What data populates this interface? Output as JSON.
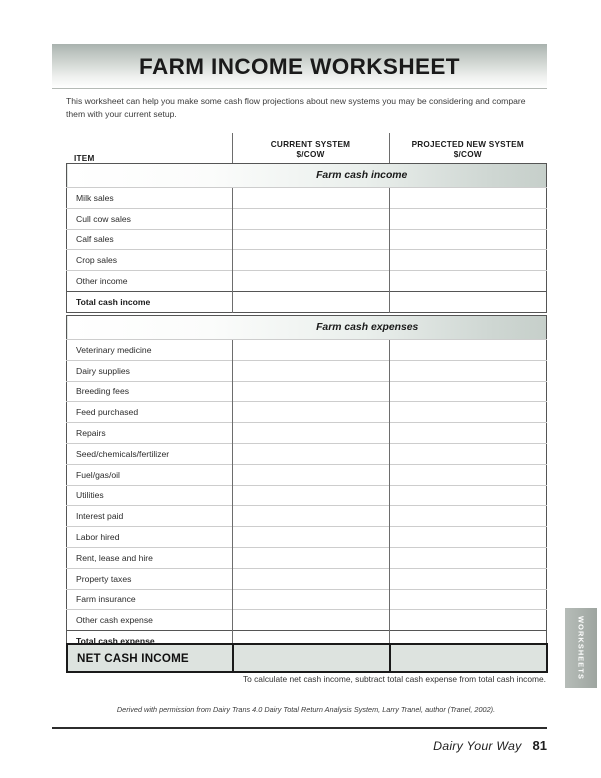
{
  "document": {
    "title": "FARM INCOME WORKSHEET",
    "intro": "This worksheet can help you make some cash flow projections about new systems you may be considering and compare them with your current setup."
  },
  "table": {
    "headers": {
      "item": "ITEM",
      "current_system_line1": "CURRENT SYSTEM",
      "current_system_line2": "$/COW",
      "projected_system_line1": "PROJECTED NEW SYSTEM",
      "projected_system_line2": "$/COW"
    },
    "income": {
      "section_title": "Farm cash income",
      "rows": [
        {
          "label": "Milk sales",
          "current": "",
          "projected": ""
        },
        {
          "label": "Cull cow sales",
          "current": "",
          "projected": ""
        },
        {
          "label": "Calf sales",
          "current": "",
          "projected": ""
        },
        {
          "label": "Crop sales",
          "current": "",
          "projected": ""
        },
        {
          "label": "Other income",
          "current": "",
          "projected": ""
        }
      ],
      "total": {
        "label": "Total cash income",
        "current": "",
        "projected": ""
      }
    },
    "expenses": {
      "section_title": "Farm cash expenses",
      "rows": [
        {
          "label": "Veterinary medicine",
          "current": "",
          "projected": ""
        },
        {
          "label": "Dairy supplies",
          "current": "",
          "projected": ""
        },
        {
          "label": "Breeding fees",
          "current": "",
          "projected": ""
        },
        {
          "label": "Feed purchased",
          "current": "",
          "projected": ""
        },
        {
          "label": "Repairs",
          "current": "",
          "projected": ""
        },
        {
          "label": "Seed/chemicals/fertilizer",
          "current": "",
          "projected": ""
        },
        {
          "label": "Fuel/gas/oil",
          "current": "",
          "projected": ""
        },
        {
          "label": "Utilities",
          "current": "",
          "projected": ""
        },
        {
          "label": "Interest paid",
          "current": "",
          "projected": ""
        },
        {
          "label": "Labor hired",
          "current": "",
          "projected": ""
        },
        {
          "label": "Rent, lease and hire",
          "current": "",
          "projected": ""
        },
        {
          "label": "Property taxes",
          "current": "",
          "projected": ""
        },
        {
          "label": "Farm insurance",
          "current": "",
          "projected": ""
        },
        {
          "label": "Other cash expense",
          "current": "",
          "projected": ""
        }
      ],
      "total": {
        "label": "Total cash expense",
        "current": "",
        "projected": ""
      }
    },
    "net": {
      "label": "NET CASH INCOME",
      "current": "",
      "projected": ""
    }
  },
  "notes": {
    "calculation": "To calculate net cash income, subtract total cash expense from total cash income.",
    "derived": "Derived with permission from Dairy Trans 4.0 Dairy Total Return Analysis System, Larry Tranel, author (Tranel, 2002)."
  },
  "footer": {
    "book_title": "Dairy Your Way",
    "page_number": "81"
  },
  "side_tab": {
    "label": "WORKSHEETS"
  },
  "colors": {
    "band_accent": "#c6cfca",
    "net_fill": "#dde3df",
    "side_tab": "#a9b0ab",
    "rule": "#2c2c2c"
  }
}
